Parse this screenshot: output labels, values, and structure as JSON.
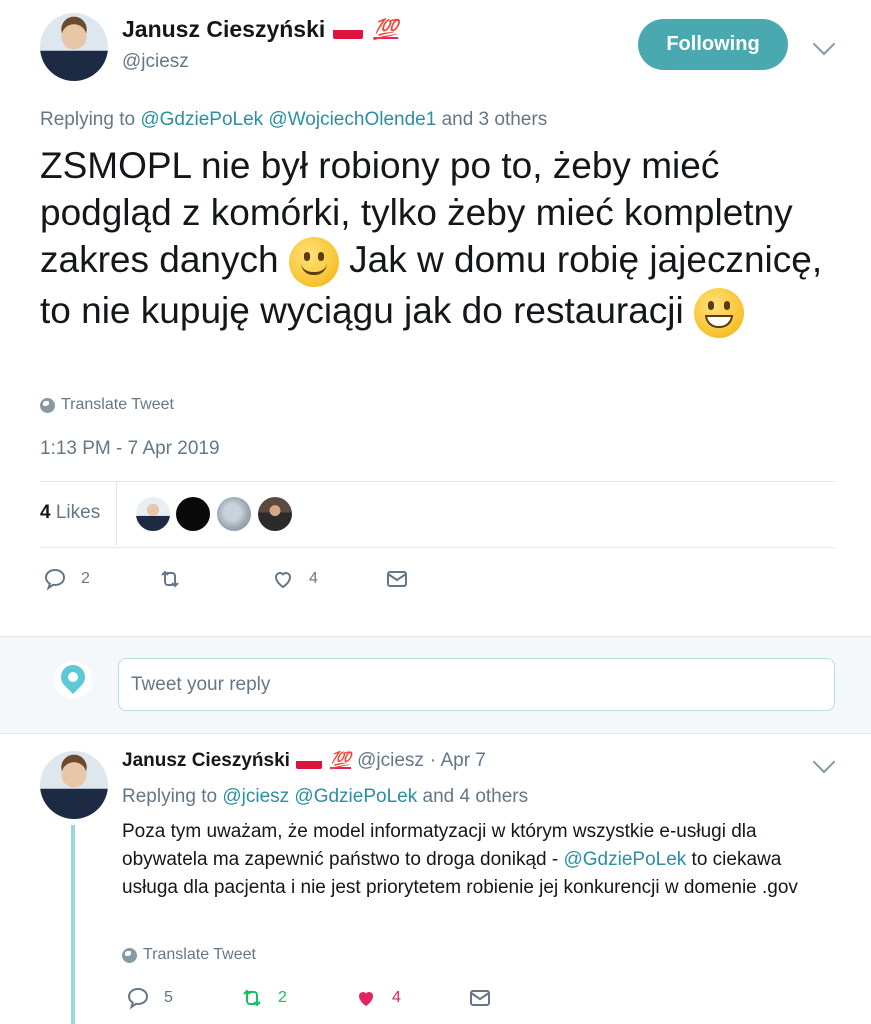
{
  "tweet": {
    "author_name": "Janusz Cieszyński",
    "author_badge": "💯",
    "handle": "@jciesz",
    "follow_label": "Following",
    "replying_prefix": "Replying to",
    "replying_mention_1": "@GdziePoLek",
    "replying_mention_2": "@WojciechOlende1",
    "replying_suffix": "and 3 others",
    "text_part1": "ZSMOPL nie był robiony po to, żeby mieć podgląd z komórki, tylko żeby mieć kompletny zakres danych",
    "text_part2": "Jak w domu robię jajecznicę, to nie kupuję wyciągu jak do restauracji",
    "translate_label": "Translate Tweet",
    "timestamp": "1:13 PM - 7 Apr 2019",
    "likes_count": "4",
    "likes_label": "Likes",
    "actions": {
      "replies": "2",
      "retweets": "",
      "likes": "4"
    }
  },
  "reply_box": {
    "placeholder": "Tweet your reply"
  },
  "reply": {
    "author_name": "Janusz Cieszyński",
    "author_badge": "💯",
    "handle": "@jciesz",
    "time": "· Apr 7",
    "replying_prefix": "Replying to",
    "replying_mention_1": "@jciesz",
    "replying_mention_2": "@GdziePoLek",
    "replying_suffix": "and 4 others",
    "text_part1": "Poza tym uważam, że model informatyzacji w którym wszystkie e-usługi dla obywatela ma zapewnić państwo to droga donikąd - ",
    "text_mention": "@GdziePoLek",
    "text_part2": " to ciekawa usługa dla pacjenta i nie jest priorytetem robienie jej konkurencji w domenie .gov",
    "translate_label": "Translate Tweet",
    "actions": {
      "replies": "5",
      "retweets": "2",
      "likes": "4"
    }
  },
  "colors": {
    "accent": "#4aa9b0",
    "link": "#2a8fa0",
    "retweet": "#17bf63",
    "like": "#e0245e",
    "muted": "#657786"
  }
}
